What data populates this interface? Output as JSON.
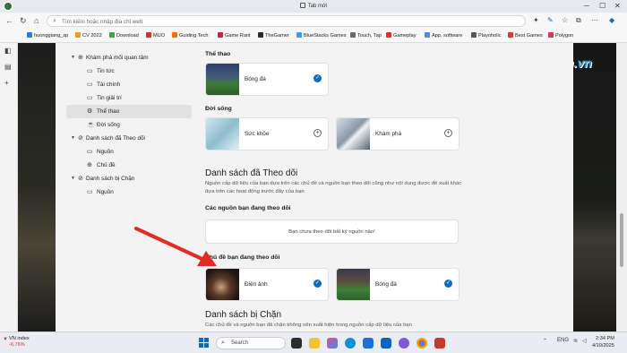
{
  "titlebar": {
    "tab_title": "Tab mới"
  },
  "addressbar": {
    "placeholder": "Tìm kiếm hoặc nhập địa chỉ web"
  },
  "favorites": [
    {
      "label": "huonggiang_sp",
      "color": "#2b7bd8"
    },
    {
      "label": "CV 2022",
      "color": "#e8a020"
    },
    {
      "label": "Download",
      "color": "#3aa645"
    },
    {
      "label": "MUO",
      "color": "#d22f2f"
    },
    {
      "label": "Guiding Tech",
      "color": "#ff6a00"
    },
    {
      "label": "Game Rant",
      "color": "#d21f3c"
    },
    {
      "label": "TheGamer",
      "color": "#2a2a2a"
    },
    {
      "label": "BlueStacks Games",
      "color": "#34a1e8"
    },
    {
      "label": "Touch, Tap",
      "color": "#6b6b6b"
    },
    {
      "label": "Gameplay",
      "color": "#e23030"
    },
    {
      "label": "App, software",
      "color": "#4b8dd6"
    },
    {
      "label": "Playoholic",
      "color": "#555555"
    },
    {
      "label": "Best Games",
      "color": "#d83a3a"
    },
    {
      "label": "Polygon",
      "color": "#e5305a"
    }
  ],
  "nav": {
    "explore": "Khám phá mối quan tâm",
    "news": "Tin tức",
    "finance": "Tài chính",
    "entertainment": "Tin giải trí",
    "sports": "Thể thao",
    "life": "Đời sống",
    "following": "Danh sách đã Theo dõi",
    "sources": "Nguồn",
    "topics": "Chủ đề",
    "blocked": "Danh sách bị Chặn",
    "blocked_sources": "Nguồn"
  },
  "content": {
    "sports_heading": "Thể thao",
    "life_heading": "Đời sống",
    "following_title": "Danh sách đã Theo dõi",
    "following_desc": "Nguồn cấp dữ liệu của bạn dựa trên các chủ đề và nguồn bạn theo dõi cũng như nội dung được đề xuất khác dựa trên các hoạt động trước đây của bạn",
    "followed_sources_heading": "Các nguồn bạn đang theo dõi",
    "no_sources_text": "Bạn chưa theo dõi bất kỳ nguồn nào!",
    "followed_topics_heading": "Chủ đề bạn đang theo dõi",
    "blocked_title": "Danh sách bị Chặn",
    "blocked_desc": "Các chủ đề và nguồn bạn đã chặn không nên xuất hiện trong nguồn cấp dữ liệu của bạn"
  },
  "cards": {
    "football": "Bóng đá",
    "health": "Sức khỏe",
    "explore": "Khám phá",
    "movies": "Điện ảnh",
    "football2": "Bóng đá"
  },
  "logo": {
    "text": "Download.com.vn"
  },
  "taskbar": {
    "stock_name": "VN index",
    "stock_change": "-6,76%",
    "search_label": "Search",
    "lang": "ENG",
    "time": "2:34 PM",
    "date": "4/10/2025"
  },
  "colors": {
    "accent": "#0f6cbd",
    "arrow": "#e32b24"
  }
}
